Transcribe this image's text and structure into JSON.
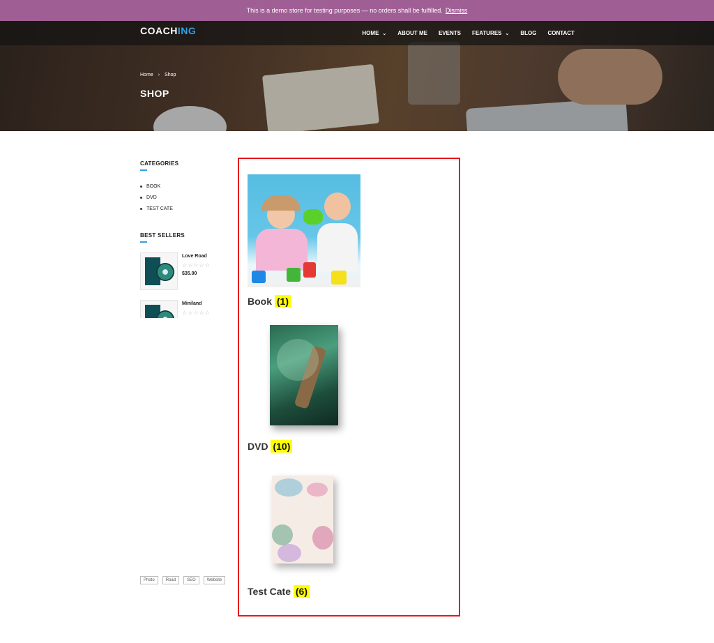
{
  "demo_notice": {
    "text": "This is a demo store for testing purposes — no orders shall be fulfilled.",
    "dismiss_label": "Dismiss"
  },
  "header": {
    "logo_main": "COACH",
    "logo_accent": "ING",
    "menu": [
      {
        "label": "HOME",
        "has_dropdown": true
      },
      {
        "label": "ABOUT ME",
        "has_dropdown": false
      },
      {
        "label": "EVENTS",
        "has_dropdown": false
      },
      {
        "label": "FEATURES",
        "has_dropdown": true
      },
      {
        "label": "BLOG",
        "has_dropdown": false
      },
      {
        "label": "CONTACT",
        "has_dropdown": false
      }
    ]
  },
  "breadcrumb": {
    "home": "Home",
    "separator": "›",
    "current": "Shop"
  },
  "page_title": "SHOP",
  "sidebar": {
    "categories_title": "CATEGORIES",
    "categories": [
      "BOOK",
      "DVD",
      "TEST CATE"
    ],
    "best_sellers_title": "BEST SELLERS",
    "best_sellers": [
      {
        "name": "Love Road",
        "rating_stars": "☆☆☆☆☆",
        "price": "$35.00"
      },
      {
        "name": "Miniland",
        "rating_stars": "☆☆☆☆☆",
        "price": ""
      }
    ],
    "tags": [
      "Photo",
      "Road",
      "SEO",
      "Website"
    ]
  },
  "product_categories": [
    {
      "name": "Book",
      "count": "(1)"
    },
    {
      "name": "DVD",
      "count": "(10)"
    },
    {
      "name": "Test Cate",
      "count": "(6)"
    }
  ],
  "colors": {
    "demo_bar": "#a05f94",
    "accent_blue": "#2f9fe6",
    "highlight_border": "#e8141b",
    "count_highlight": "#ffff00"
  }
}
